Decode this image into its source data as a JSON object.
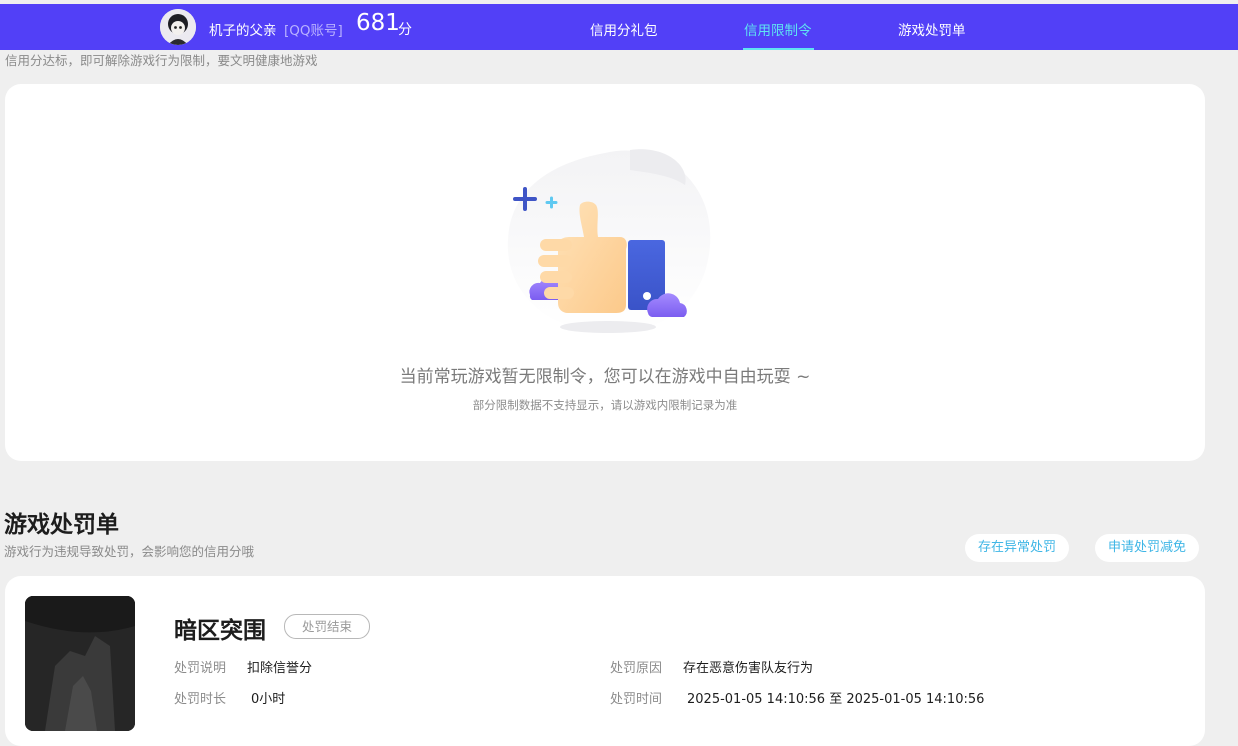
{
  "header": {
    "username": "机子的父亲",
    "account_type": "[QQ账号]",
    "score": "681",
    "score_unit": "分",
    "tabs": [
      {
        "label": "信用分礼包",
        "active": false
      },
      {
        "label": "信用限制令",
        "active": true
      },
      {
        "label": "游戏处罚单",
        "active": false
      }
    ]
  },
  "restriction": {
    "subtitle": "信用分达标，即可解除游戏行为限制，要文明健康地游戏",
    "empty_message": "当前常玩游戏暂无限制令，您可以在游戏中自由玩耍 ~",
    "empty_note": "部分限制数据不支持显示，请以游戏内限制记录为准"
  },
  "penalty": {
    "title": "游戏处罚单",
    "subtitle": "游戏行为违规导致处罚，会影响您的信用分哦",
    "buttons": {
      "report_abnormal": "存在异常处罚",
      "apply_reduction": "申请处罚减免"
    },
    "items": [
      {
        "game": "暗区突围",
        "status": "处罚结束",
        "desc_label": "处罚说明",
        "desc_value": "扣除信誉分",
        "duration_label": "处罚时长",
        "duration_value": "0小时",
        "reason_label": "处罚原因",
        "reason_value": "存在恶意伤害队友行为",
        "time_label": "处罚时间",
        "time_value": "2025-01-05 14:10:56 至 2025-01-05 14:10:56"
      }
    ]
  },
  "colors": {
    "topbar": "#5240f7",
    "active_tab": "#5fe3f2",
    "link_button": "#3fb6e6",
    "page_bg": "#efefef"
  }
}
